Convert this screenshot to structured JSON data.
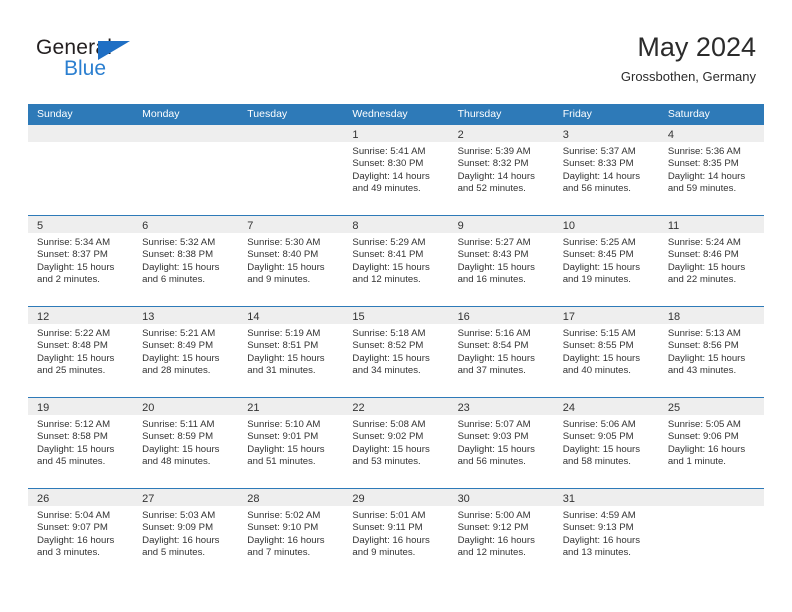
{
  "brand": {
    "name_top": "General",
    "name_bottom": "Blue",
    "triangle_color": "#1f6fc4",
    "blue_color": "#2b7fd0"
  },
  "header": {
    "title": "May 2024",
    "subtitle": "Grossbothen, Germany"
  },
  "theme": {
    "header_bar": "#2e7ab8",
    "cell_head": "#eeeeee",
    "text": "#333333"
  },
  "weekdays": [
    "Sunday",
    "Monday",
    "Tuesday",
    "Wednesday",
    "Thursday",
    "Friday",
    "Saturday"
  ],
  "weeks": [
    [
      {
        "empty": true,
        "day": "",
        "sunrise": "",
        "sunset": "",
        "daylight1": "",
        "daylight2": ""
      },
      {
        "empty": true,
        "day": "",
        "sunrise": "",
        "sunset": "",
        "daylight1": "",
        "daylight2": ""
      },
      {
        "empty": true,
        "day": "",
        "sunrise": "",
        "sunset": "",
        "daylight1": "",
        "daylight2": ""
      },
      {
        "empty": false,
        "day": "1",
        "sunrise": "Sunrise: 5:41 AM",
        "sunset": "Sunset: 8:30 PM",
        "daylight1": "Daylight: 14 hours",
        "daylight2": "and 49 minutes."
      },
      {
        "empty": false,
        "day": "2",
        "sunrise": "Sunrise: 5:39 AM",
        "sunset": "Sunset: 8:32 PM",
        "daylight1": "Daylight: 14 hours",
        "daylight2": "and 52 minutes."
      },
      {
        "empty": false,
        "day": "3",
        "sunrise": "Sunrise: 5:37 AM",
        "sunset": "Sunset: 8:33 PM",
        "daylight1": "Daylight: 14 hours",
        "daylight2": "and 56 minutes."
      },
      {
        "empty": false,
        "day": "4",
        "sunrise": "Sunrise: 5:36 AM",
        "sunset": "Sunset: 8:35 PM",
        "daylight1": "Daylight: 14 hours",
        "daylight2": "and 59 minutes."
      }
    ],
    [
      {
        "empty": false,
        "day": "5",
        "sunrise": "Sunrise: 5:34 AM",
        "sunset": "Sunset: 8:37 PM",
        "daylight1": "Daylight: 15 hours",
        "daylight2": "and 2 minutes."
      },
      {
        "empty": false,
        "day": "6",
        "sunrise": "Sunrise: 5:32 AM",
        "sunset": "Sunset: 8:38 PM",
        "daylight1": "Daylight: 15 hours",
        "daylight2": "and 6 minutes."
      },
      {
        "empty": false,
        "day": "7",
        "sunrise": "Sunrise: 5:30 AM",
        "sunset": "Sunset: 8:40 PM",
        "daylight1": "Daylight: 15 hours",
        "daylight2": "and 9 minutes."
      },
      {
        "empty": false,
        "day": "8",
        "sunrise": "Sunrise: 5:29 AM",
        "sunset": "Sunset: 8:41 PM",
        "daylight1": "Daylight: 15 hours",
        "daylight2": "and 12 minutes."
      },
      {
        "empty": false,
        "day": "9",
        "sunrise": "Sunrise: 5:27 AM",
        "sunset": "Sunset: 8:43 PM",
        "daylight1": "Daylight: 15 hours",
        "daylight2": "and 16 minutes."
      },
      {
        "empty": false,
        "day": "10",
        "sunrise": "Sunrise: 5:25 AM",
        "sunset": "Sunset: 8:45 PM",
        "daylight1": "Daylight: 15 hours",
        "daylight2": "and 19 minutes."
      },
      {
        "empty": false,
        "day": "11",
        "sunrise": "Sunrise: 5:24 AM",
        "sunset": "Sunset: 8:46 PM",
        "daylight1": "Daylight: 15 hours",
        "daylight2": "and 22 minutes."
      }
    ],
    [
      {
        "empty": false,
        "day": "12",
        "sunrise": "Sunrise: 5:22 AM",
        "sunset": "Sunset: 8:48 PM",
        "daylight1": "Daylight: 15 hours",
        "daylight2": "and 25 minutes."
      },
      {
        "empty": false,
        "day": "13",
        "sunrise": "Sunrise: 5:21 AM",
        "sunset": "Sunset: 8:49 PM",
        "daylight1": "Daylight: 15 hours",
        "daylight2": "and 28 minutes."
      },
      {
        "empty": false,
        "day": "14",
        "sunrise": "Sunrise: 5:19 AM",
        "sunset": "Sunset: 8:51 PM",
        "daylight1": "Daylight: 15 hours",
        "daylight2": "and 31 minutes."
      },
      {
        "empty": false,
        "day": "15",
        "sunrise": "Sunrise: 5:18 AM",
        "sunset": "Sunset: 8:52 PM",
        "daylight1": "Daylight: 15 hours",
        "daylight2": "and 34 minutes."
      },
      {
        "empty": false,
        "day": "16",
        "sunrise": "Sunrise: 5:16 AM",
        "sunset": "Sunset: 8:54 PM",
        "daylight1": "Daylight: 15 hours",
        "daylight2": "and 37 minutes."
      },
      {
        "empty": false,
        "day": "17",
        "sunrise": "Sunrise: 5:15 AM",
        "sunset": "Sunset: 8:55 PM",
        "daylight1": "Daylight: 15 hours",
        "daylight2": "and 40 minutes."
      },
      {
        "empty": false,
        "day": "18",
        "sunrise": "Sunrise: 5:13 AM",
        "sunset": "Sunset: 8:56 PM",
        "daylight1": "Daylight: 15 hours",
        "daylight2": "and 43 minutes."
      }
    ],
    [
      {
        "empty": false,
        "day": "19",
        "sunrise": "Sunrise: 5:12 AM",
        "sunset": "Sunset: 8:58 PM",
        "daylight1": "Daylight: 15 hours",
        "daylight2": "and 45 minutes."
      },
      {
        "empty": false,
        "day": "20",
        "sunrise": "Sunrise: 5:11 AM",
        "sunset": "Sunset: 8:59 PM",
        "daylight1": "Daylight: 15 hours",
        "daylight2": "and 48 minutes."
      },
      {
        "empty": false,
        "day": "21",
        "sunrise": "Sunrise: 5:10 AM",
        "sunset": "Sunset: 9:01 PM",
        "daylight1": "Daylight: 15 hours",
        "daylight2": "and 51 minutes."
      },
      {
        "empty": false,
        "day": "22",
        "sunrise": "Sunrise: 5:08 AM",
        "sunset": "Sunset: 9:02 PM",
        "daylight1": "Daylight: 15 hours",
        "daylight2": "and 53 minutes."
      },
      {
        "empty": false,
        "day": "23",
        "sunrise": "Sunrise: 5:07 AM",
        "sunset": "Sunset: 9:03 PM",
        "daylight1": "Daylight: 15 hours",
        "daylight2": "and 56 minutes."
      },
      {
        "empty": false,
        "day": "24",
        "sunrise": "Sunrise: 5:06 AM",
        "sunset": "Sunset: 9:05 PM",
        "daylight1": "Daylight: 15 hours",
        "daylight2": "and 58 minutes."
      },
      {
        "empty": false,
        "day": "25",
        "sunrise": "Sunrise: 5:05 AM",
        "sunset": "Sunset: 9:06 PM",
        "daylight1": "Daylight: 16 hours",
        "daylight2": "and 1 minute."
      }
    ],
    [
      {
        "empty": false,
        "day": "26",
        "sunrise": "Sunrise: 5:04 AM",
        "sunset": "Sunset: 9:07 PM",
        "daylight1": "Daylight: 16 hours",
        "daylight2": "and 3 minutes."
      },
      {
        "empty": false,
        "day": "27",
        "sunrise": "Sunrise: 5:03 AM",
        "sunset": "Sunset: 9:09 PM",
        "daylight1": "Daylight: 16 hours",
        "daylight2": "and 5 minutes."
      },
      {
        "empty": false,
        "day": "28",
        "sunrise": "Sunrise: 5:02 AM",
        "sunset": "Sunset: 9:10 PM",
        "daylight1": "Daylight: 16 hours",
        "daylight2": "and 7 minutes."
      },
      {
        "empty": false,
        "day": "29",
        "sunrise": "Sunrise: 5:01 AM",
        "sunset": "Sunset: 9:11 PM",
        "daylight1": "Daylight: 16 hours",
        "daylight2": "and 9 minutes."
      },
      {
        "empty": false,
        "day": "30",
        "sunrise": "Sunrise: 5:00 AM",
        "sunset": "Sunset: 9:12 PM",
        "daylight1": "Daylight: 16 hours",
        "daylight2": "and 12 minutes."
      },
      {
        "empty": false,
        "day": "31",
        "sunrise": "Sunrise: 4:59 AM",
        "sunset": "Sunset: 9:13 PM",
        "daylight1": "Daylight: 16 hours",
        "daylight2": "and 13 minutes."
      },
      {
        "empty": true,
        "day": "",
        "sunrise": "",
        "sunset": "",
        "daylight1": "",
        "daylight2": ""
      }
    ]
  ]
}
